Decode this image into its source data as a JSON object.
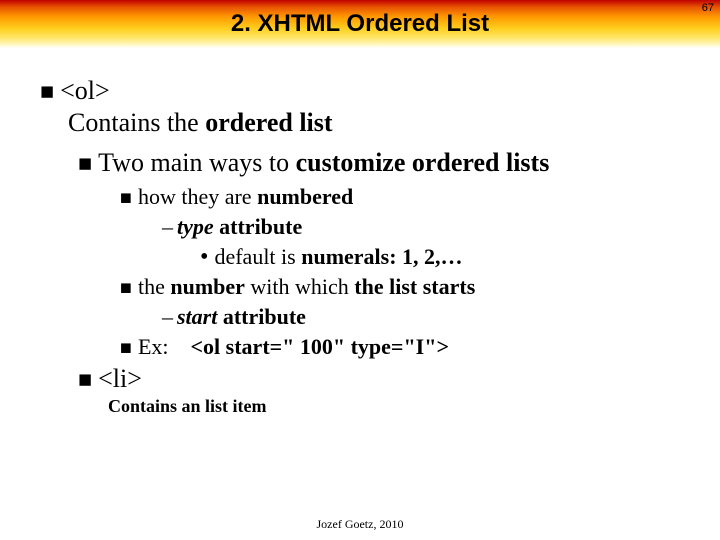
{
  "pageNumber": "67",
  "title": "2. XHTML Ordered List",
  "b1": {
    "tag": "<ol>",
    "desc_a": "Contains the ",
    "desc_b": "ordered list"
  },
  "b2": {
    "a": "Two main ways to ",
    "b": "customize ordered lists"
  },
  "b3": {
    "a": "how they are ",
    "b": "numbered"
  },
  "b4": {
    "a": "type",
    "b": " attribute"
  },
  "b5": {
    "a": "default is ",
    "b": "numerals: 1, 2,…"
  },
  "b6": {
    "a": "the ",
    "b": "number",
    "c": " with which ",
    "d": "the list starts"
  },
  "b7": {
    "a": "start",
    "b": " attribute"
  },
  "b8": {
    "label": "Ex:",
    "code": "<ol start=\" 100\" type=\"I\">"
  },
  "b9": {
    "tag": "<li>"
  },
  "b10": {
    "a": "Contains an ",
    "b": "list item"
  },
  "footer": "Jozef Goetz, 2010"
}
